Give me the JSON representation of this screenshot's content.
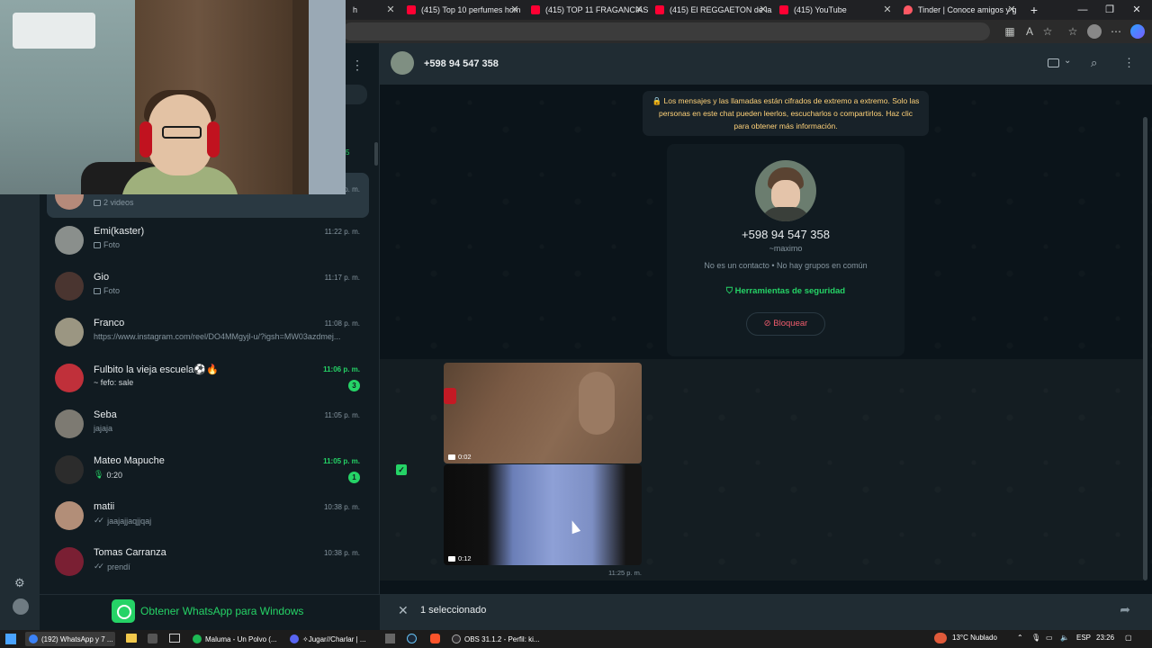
{
  "browser": {
    "tabs": [
      {
        "label": "h",
        "icon": "none"
      },
      {
        "label": "(415) Top 10 perfumes hom",
        "icon": "youtube-icon"
      },
      {
        "label": "(415) TOP 11 FRAGANCIAS",
        "icon": "youtube-icon"
      },
      {
        "label": "(415) El REGGAETON de la",
        "icon": "youtube-icon"
      },
      {
        "label": "(415) YouTube",
        "icon": "youtube-icon"
      },
      {
        "label": "Tinder | Conoce amigos y g",
        "icon": "tinder-icon"
      }
    ],
    "new_tab": "+",
    "close_glyph": "✕",
    "window_controls": [
      "—",
      "❐",
      "✕"
    ]
  },
  "chats": [
    {
      "name": "",
      "preview": "2 videos",
      "preview_icon": "picture-icon",
      "time": "p. m.",
      "unread": "",
      "selected": true
    },
    {
      "name": "Emi(kaster)",
      "preview": "Foto",
      "preview_icon": "picture-icon",
      "time": "11:22 p. m.",
      "unread": ""
    },
    {
      "name": "Gio",
      "preview": "Foto",
      "preview_icon": "picture-icon",
      "time": "11:17 p. m.",
      "unread": ""
    },
    {
      "name": "Franco",
      "preview": "https://www.instagram.com/reel/DO4MMgyjl-u/?igsh=MW03azdmej...",
      "preview_icon": "",
      "time": "11:08 p. m.",
      "unread": ""
    },
    {
      "name": "Fulbito la vieja escuela⚽🔥",
      "preview": "~ fefo: sale",
      "preview_icon": "",
      "time": "11:06 p. m.",
      "unread": "3"
    },
    {
      "name": "Seba",
      "preview": "jajaja",
      "preview_icon": "",
      "time": "11:05 p. m.",
      "unread": ""
    },
    {
      "name": "Mateo Mapuche",
      "preview": "0:20",
      "preview_icon": "mic-icon",
      "time": "11:05 p. m.",
      "unread": "1"
    },
    {
      "name": "matii",
      "preview": "jaajajjaqjjqaj",
      "preview_icon": "double-tick-icon",
      "time": "10:38 p. m.",
      "unread": ""
    },
    {
      "name": "Tomas Carranza",
      "preview": "prendí",
      "preview_icon": "double-tick-icon",
      "time": "10:38 p. m.",
      "unread": ""
    }
  ],
  "left_badge": "5",
  "cta": {
    "label": "Obtener WhatsApp para Windows"
  },
  "header": {
    "phone": "+598 94 547 358"
  },
  "encryption_notice": "🔒 Los mensajes y las llamadas están cifrados de extremo a extremo. Solo las personas en este chat pueden leerlos, escucharlos o compartirlos. Haz clic para obtener más información.",
  "contact_card": {
    "phone": "+598 94 547 358",
    "alias": "~maximo",
    "info": "No es un contacto • No hay grupos en común",
    "security_tools": "Herramientas de seguridad",
    "block": "Bloquear"
  },
  "videos": [
    {
      "duration": "0:02"
    },
    {
      "duration": "0:12"
    }
  ],
  "message_time": "11:25 p. m.",
  "selection": {
    "count_label": "1 seleccionado"
  },
  "taskbar": {
    "apps": [
      {
        "label": "(192) WhatsApp y 7 ...",
        "color": "#3b82f6"
      },
      {
        "label": "Maluma - Un Polvo (...",
        "color": "#1db954"
      },
      {
        "label": "✧Jugar//Charlar | ...",
        "color": "#5865f2"
      },
      {
        "label": "OBS 31.1.2 - Perfil: ki...",
        "color": "#302e31"
      }
    ],
    "weather": "13°C  Nublado",
    "lang": "ESP",
    "clock": "23:26"
  },
  "colors": {
    "accent": "#25d366",
    "danger": "#f15c6d",
    "notice": "#ffd279"
  }
}
